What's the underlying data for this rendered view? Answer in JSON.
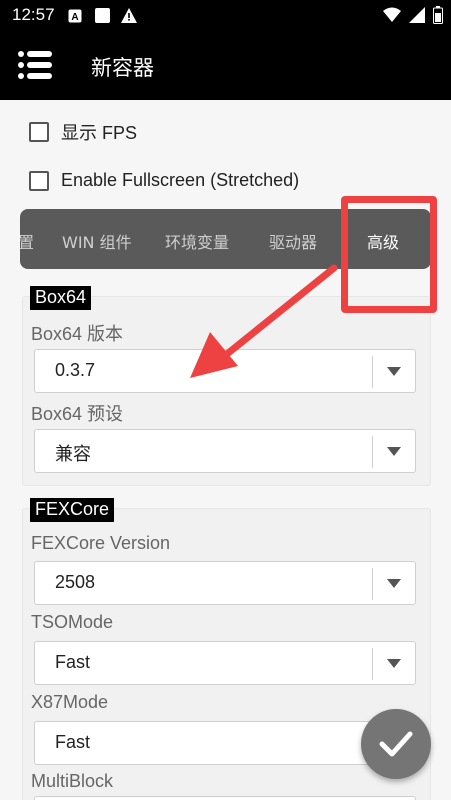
{
  "status_bar": {
    "time": "12:57",
    "icons": [
      "a-box-icon",
      "square-icon",
      "warning-icon",
      "wifi-icon",
      "signal-icon",
      "battery-icon"
    ]
  },
  "app_bar": {
    "title": "新容器",
    "menu_icon": "menu-icon"
  },
  "checkboxes": [
    {
      "label": "显示 FPS",
      "checked": false
    },
    {
      "label": "Enable Fullscreen (Stretched)",
      "checked": false
    }
  ],
  "tabs": [
    {
      "label": "置"
    },
    {
      "label": "WIN 组件"
    },
    {
      "label": "环境变量"
    },
    {
      "label": "驱动器"
    },
    {
      "label": "高级",
      "active": true
    }
  ],
  "box64": {
    "header": "Box64",
    "version_label": "Box64 版本",
    "version_value": "0.3.7",
    "preset_label": "Box64 预设",
    "preset_value": "兼容"
  },
  "fexcore": {
    "header": "FEXCore",
    "version_label": "FEXCore Version",
    "version_value": "2508",
    "tso_label": "TSOMode",
    "tso_value": "Fast",
    "x87_label": "X87Mode",
    "x87_value": "Fast",
    "multiblock_label": "MultiBlock"
  },
  "fab": {
    "icon": "check-icon"
  },
  "colors": {
    "accent_red": "#ee4142",
    "tab_bg": "#5a5a5a",
    "bar_bg": "#000000",
    "fab_bg": "#757575"
  }
}
